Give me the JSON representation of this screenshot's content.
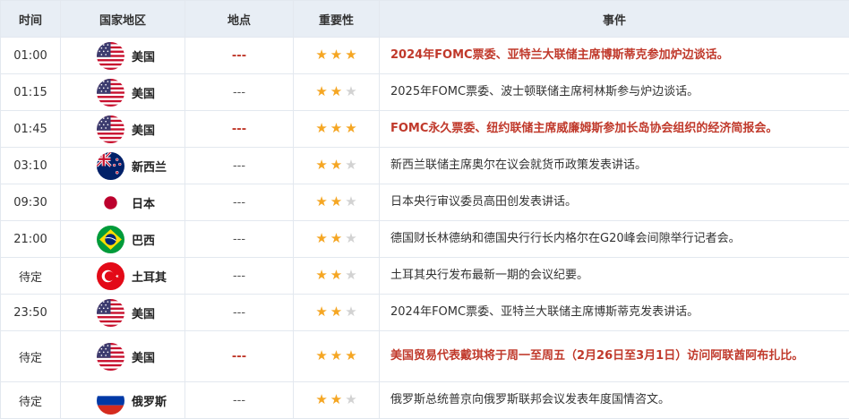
{
  "headers": {
    "time": "时间",
    "country": "国家地区",
    "location": "地点",
    "importance": "重要性",
    "event": "事件"
  },
  "rows": [
    {
      "time": "01:00",
      "country": "美国",
      "flag": "us-flag-icon",
      "location": "---",
      "stars": 3,
      "event": "2024年FOMC票委、亚特兰大联储主席博斯蒂克参加炉边谈话。",
      "important": true
    },
    {
      "time": "01:15",
      "country": "美国",
      "flag": "us-flag-icon",
      "location": "---",
      "stars": 2,
      "event": "2025年FOMC票委、波士顿联储主席柯林斯参与炉边谈话。",
      "important": false
    },
    {
      "time": "01:45",
      "country": "美国",
      "flag": "us-flag-icon",
      "location": "---",
      "stars": 3,
      "event": "FOMC永久票委、纽约联储主席威廉姆斯参加长岛协会组织的经济简报会。",
      "important": true
    },
    {
      "time": "03:10",
      "country": "新西兰",
      "flag": "nz-flag-icon",
      "location": "---",
      "stars": 2,
      "event": "新西兰联储主席奥尔在议会就货币政策发表讲话。",
      "important": false
    },
    {
      "time": "09:30",
      "country": "日本",
      "flag": "jp-flag-icon",
      "location": "---",
      "stars": 2,
      "event": "日本央行审议委员高田创发表讲话。",
      "important": false
    },
    {
      "time": "21:00",
      "country": "巴西",
      "flag": "br-flag-icon",
      "location": "---",
      "stars": 2,
      "event": "德国财长林德纳和德国央行行长内格尔在G20峰会间隙举行记者会。",
      "important": false
    },
    {
      "time": "待定",
      "country": "土耳其",
      "flag": "tr-flag-icon",
      "location": "---",
      "stars": 2,
      "event": "土耳其央行发布最新一期的会议纪要。",
      "important": false
    },
    {
      "time": "23:50",
      "country": "美国",
      "flag": "us-flag-icon",
      "location": "---",
      "stars": 2,
      "event": "2024年FOMC票委、亚特兰大联储主席博斯蒂克发表讲话。",
      "important": false
    },
    {
      "time": "待定",
      "country": "美国",
      "flag": "us-flag-icon",
      "location": "---",
      "stars": 3,
      "event": "美国贸易代表戴琪将于周一至周五（2月26日至3月1日）访问阿联酋阿布扎比。",
      "important": true
    },
    {
      "time": "待定",
      "country": "俄罗斯",
      "flag": "ru-flag-icon",
      "location": "---",
      "stars": 2,
      "event": "俄罗斯总统普京向俄罗斯联邦会议发表年度国情咨文。",
      "important": false
    }
  ],
  "colors": {
    "important_text": "#c0392b",
    "star_on": "#f5a623",
    "star_off": "#d2d2d2",
    "header_bg": "#e8eef5"
  }
}
